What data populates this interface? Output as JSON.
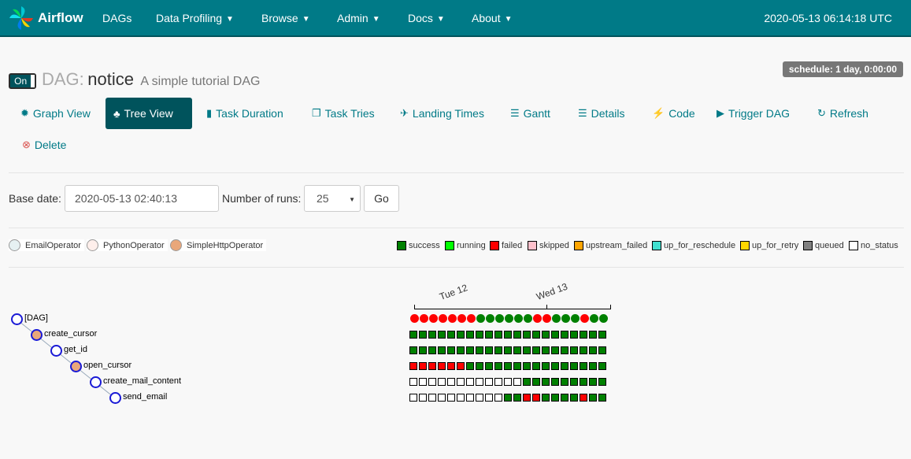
{
  "navbar": {
    "brand": "Airflow",
    "items": [
      "DAGs",
      "Data Profiling",
      "Browse",
      "Admin",
      "Docs",
      "About"
    ],
    "dropdown": [
      false,
      true,
      true,
      true,
      true,
      true
    ],
    "clock": "2020-05-13 06:14:18 UTC"
  },
  "header": {
    "toggle_label": "On",
    "prefix": "DAG:",
    "dag_id": "notice",
    "description": "A simple tutorial DAG",
    "schedule": "schedule: 1 day, 0:00:00"
  },
  "views": {
    "graph": "Graph View",
    "tree": "Tree View",
    "duration": "Task Duration",
    "tries": "Task Tries",
    "landing": "Landing Times",
    "gantt": "Gantt",
    "details": "Details",
    "code": "Code",
    "trigger": "Trigger DAG",
    "refresh": "Refresh",
    "delete": "Delete"
  },
  "form": {
    "base_date_label": "Base date:",
    "base_date": "2020-05-13 02:40:13",
    "runs_label": "Number of runs:",
    "runs": "25",
    "go": "Go"
  },
  "operators": [
    {
      "name": "EmailOperator",
      "color": "#e6f1f2"
    },
    {
      "name": "PythonOperator",
      "color": "#ffefeb"
    },
    {
      "name": "SimpleHttpOperator",
      "color": "#e9a77a"
    }
  ],
  "states": [
    {
      "name": "success",
      "color": "#008000"
    },
    {
      "name": "running",
      "color": "#00ff00"
    },
    {
      "name": "failed",
      "color": "#ff0000"
    },
    {
      "name": "skipped",
      "color": "#ffc0cb"
    },
    {
      "name": "upstream_failed",
      "color": "#ffa500"
    },
    {
      "name": "up_for_reschedule",
      "color": "#40e0d0"
    },
    {
      "name": "up_for_retry",
      "color": "#ffd700"
    },
    {
      "name": "queued",
      "color": "#808080"
    },
    {
      "name": "no_status",
      "color": "#ffffff"
    }
  ],
  "tree": {
    "nodes": [
      {
        "label": "[DAG]",
        "fill": "#ffffff"
      },
      {
        "label": "create_cursor",
        "fill": "#e9a77a"
      },
      {
        "label": "get_id",
        "fill": "#ffffff"
      },
      {
        "label": "open_cursor",
        "fill": "#e9a77a"
      },
      {
        "label": "create_mail_content",
        "fill": "#ffffff"
      },
      {
        "label": "send_email",
        "fill": "#ffffff"
      }
    ]
  },
  "grid": {
    "axis_labels": [
      "Tue 12",
      "Wed 13"
    ],
    "dag_runs": "FFFFFFFSSSSSSFFSSSFSS",
    "rows": [
      "SSSSSSSSSSSSSSSSSSSSS",
      "SSSSSSSSSSSSSSSSSSSSS",
      "FFFFFFSSSSSSSSSSSSSSS",
      "NNNNNNNNNNNNSSSSSSSSS",
      "NNNNNNNNNNSSFFSSSSFSS"
    ]
  }
}
